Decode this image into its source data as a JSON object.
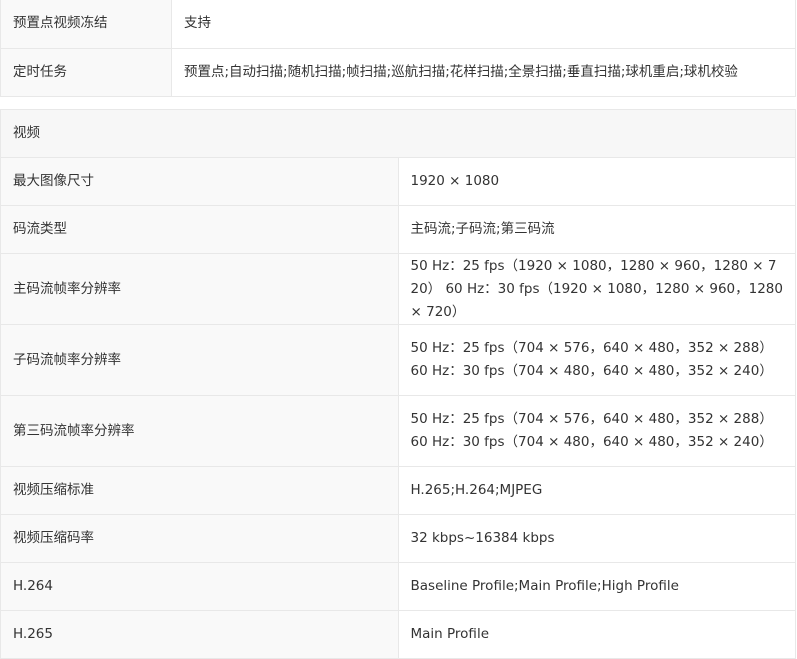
{
  "top_rows": [
    {
      "label": "预置点视频冻结",
      "value": "支持"
    },
    {
      "label": "定时任务",
      "value": "预置点;自动扫描;随机扫描;帧扫描;巡航扫描;花样扫描;全景扫描;垂直扫描;球机重启;球机校验"
    }
  ],
  "video_section": {
    "title": "视频",
    "rows": [
      {
        "label": "最大图像尺寸",
        "value": "1920 × 1080"
      },
      {
        "label": "码流类型",
        "value": "主码流;子码流;第三码流"
      },
      {
        "label": "主码流帧率分辨率",
        "value": "50 Hz：25 fps（1920 × 1080，1280 × 960，1280 × 720） 60 Hz：30 fps（1920 × 1080，1280 × 960，1280 × 720）"
      },
      {
        "label": "子码流帧率分辨率",
        "value": "50 Hz：25 fps（704 × 576，640 × 480，352 × 288） 60 Hz：30 fps（704 × 480，640 × 480，352 × 240）"
      },
      {
        "label": "第三码流帧率分辨率",
        "value": "50 Hz：25 fps（704 × 576，640 × 480，352 × 288） 60 Hz：30 fps（704 × 480，640 × 480，352 × 240）"
      },
      {
        "label": "视频压缩标准",
        "value": "H.265;H.264;MJPEG"
      },
      {
        "label": "视频压缩码率",
        "value": "32 kbps~16384 kbps"
      },
      {
        "label": "H.264",
        "value": "Baseline Profile;Main Profile;High Profile"
      },
      {
        "label": "H.265",
        "value": "Main Profile"
      }
    ]
  }
}
